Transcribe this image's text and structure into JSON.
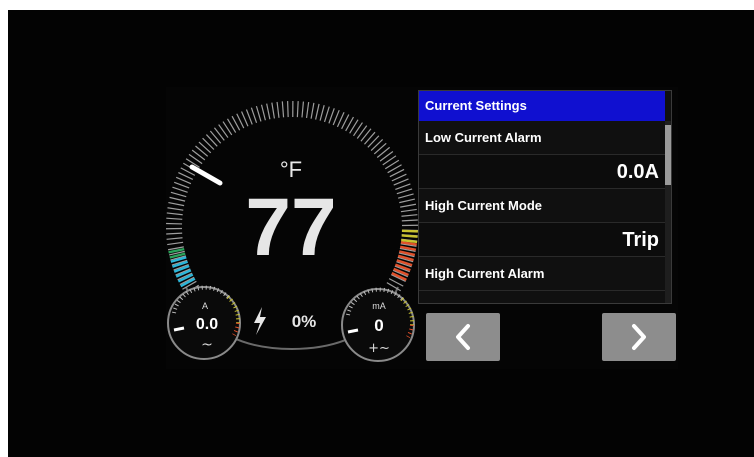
{
  "gauge": {
    "unit": "°F",
    "temperature": "77",
    "power_percent": "0%",
    "current_gauge": {
      "unit": "A",
      "value": "0.0",
      "symbol": "~"
    },
    "leakage_gauge": {
      "unit": "mA",
      "value": "0",
      "symbol": "+~"
    },
    "colors": {
      "cold": "#2ab6d9",
      "green": "#29a35a",
      "hot": "#e0502a",
      "yellow": "#c9c22e",
      "needle": "#ffffff"
    },
    "icons": {
      "power": "lightning-bolt-icon"
    }
  },
  "settings": {
    "header": "Current Settings",
    "rows": [
      {
        "label": "Low Current Alarm",
        "value": "0.0A"
      },
      {
        "label": "High Current Mode",
        "value": "Trip"
      },
      {
        "label": "High Current Alarm"
      }
    ],
    "colors": {
      "header_bg": "#1010d0"
    }
  },
  "nav": {
    "prev_icon": "chevron-left-icon",
    "next_icon": "chevron-right-icon"
  }
}
